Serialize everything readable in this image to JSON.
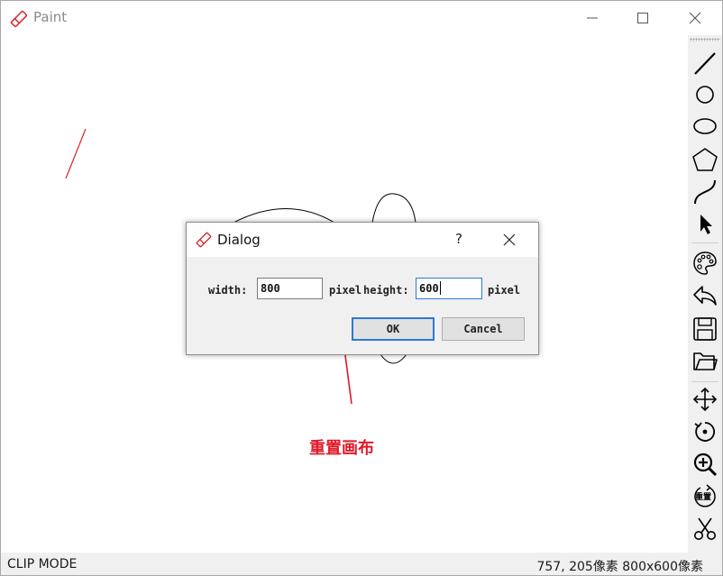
{
  "app": {
    "title": "Paint",
    "icon": "pencil-eraser-icon",
    "accent": "#d2282e"
  },
  "window_controls": {
    "minimize": "minimize-icon",
    "maximize": "maximize-icon",
    "close": "close-icon"
  },
  "toolbar": {
    "tools": [
      {
        "name": "line-tool",
        "icon": "line-icon"
      },
      {
        "name": "circle-tool",
        "icon": "circle-icon"
      },
      {
        "name": "ellipse-tool",
        "icon": "ellipse-icon"
      },
      {
        "name": "polygon-tool",
        "icon": "pentagon-icon"
      },
      {
        "name": "curve-tool",
        "icon": "curve-icon"
      },
      {
        "name": "select-tool",
        "icon": "cursor-arrow-icon"
      },
      {
        "name": "color-palette",
        "icon": "palette-icon"
      },
      {
        "name": "undo",
        "icon": "undo-arrow-icon"
      },
      {
        "name": "save",
        "icon": "save-icon"
      },
      {
        "name": "open",
        "icon": "folder-icon"
      },
      {
        "name": "move",
        "icon": "move-arrows-icon"
      },
      {
        "name": "rotate",
        "icon": "rotate-icon"
      },
      {
        "name": "zoom-in",
        "icon": "zoom-in-icon"
      },
      {
        "name": "reset-canvas",
        "icon": "reset-icon",
        "label": "重置"
      },
      {
        "name": "clip",
        "icon": "scissors-icon"
      }
    ]
  },
  "dialog": {
    "title": "Dialog",
    "help": "?",
    "width_label": "width:",
    "width_value": "800",
    "width_unit": "pixel",
    "height_label": "height:",
    "height_value": "600",
    "height_unit": "pixel",
    "ok_label": "OK",
    "cancel_label": "Cancel"
  },
  "annotation": {
    "text": "重置画布",
    "color": "#e0192a"
  },
  "status": {
    "mode": "CLIP MODE",
    "position": "757, 205像素",
    "canvas_size": "800x600像素"
  }
}
